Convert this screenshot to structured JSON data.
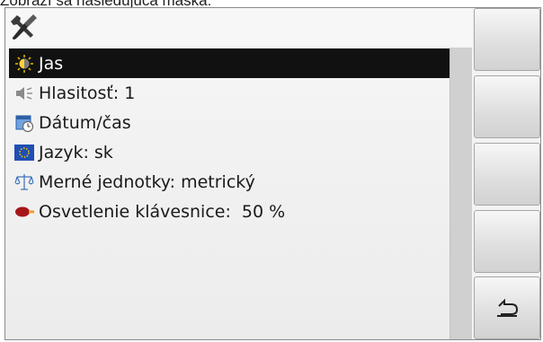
{
  "caption": "Zobrazí sa nasledujúca maska:",
  "menu": {
    "items": [
      {
        "icon": "brightness-icon",
        "label": "Jas",
        "value": "",
        "selected": true
      },
      {
        "icon": "speaker-icon",
        "label": "Hlasitosť:",
        "value": "1",
        "selected": false
      },
      {
        "icon": "calendar-clock-icon",
        "label": "Dátum/čas",
        "value": "",
        "selected": false
      },
      {
        "icon": "eu-flag-icon",
        "label": "Jazyk:",
        "value": "sk",
        "selected": false
      },
      {
        "icon": "scale-icon",
        "label": "Merné jednotky:",
        "value": "metrický",
        "selected": false
      },
      {
        "icon": "keyboard-light-icon",
        "label": "Osvetlenie klávesnice:",
        "value": " 50 %",
        "selected": false
      }
    ]
  },
  "softkeys": [
    "",
    "",
    "",
    "",
    "back-arrow-icon"
  ],
  "colors": {
    "selection": "#111111",
    "panel": "#f3f3f3",
    "scrollbar": "#d0d0d0",
    "flag": "#1f4fb3",
    "star": "#f2c200"
  }
}
